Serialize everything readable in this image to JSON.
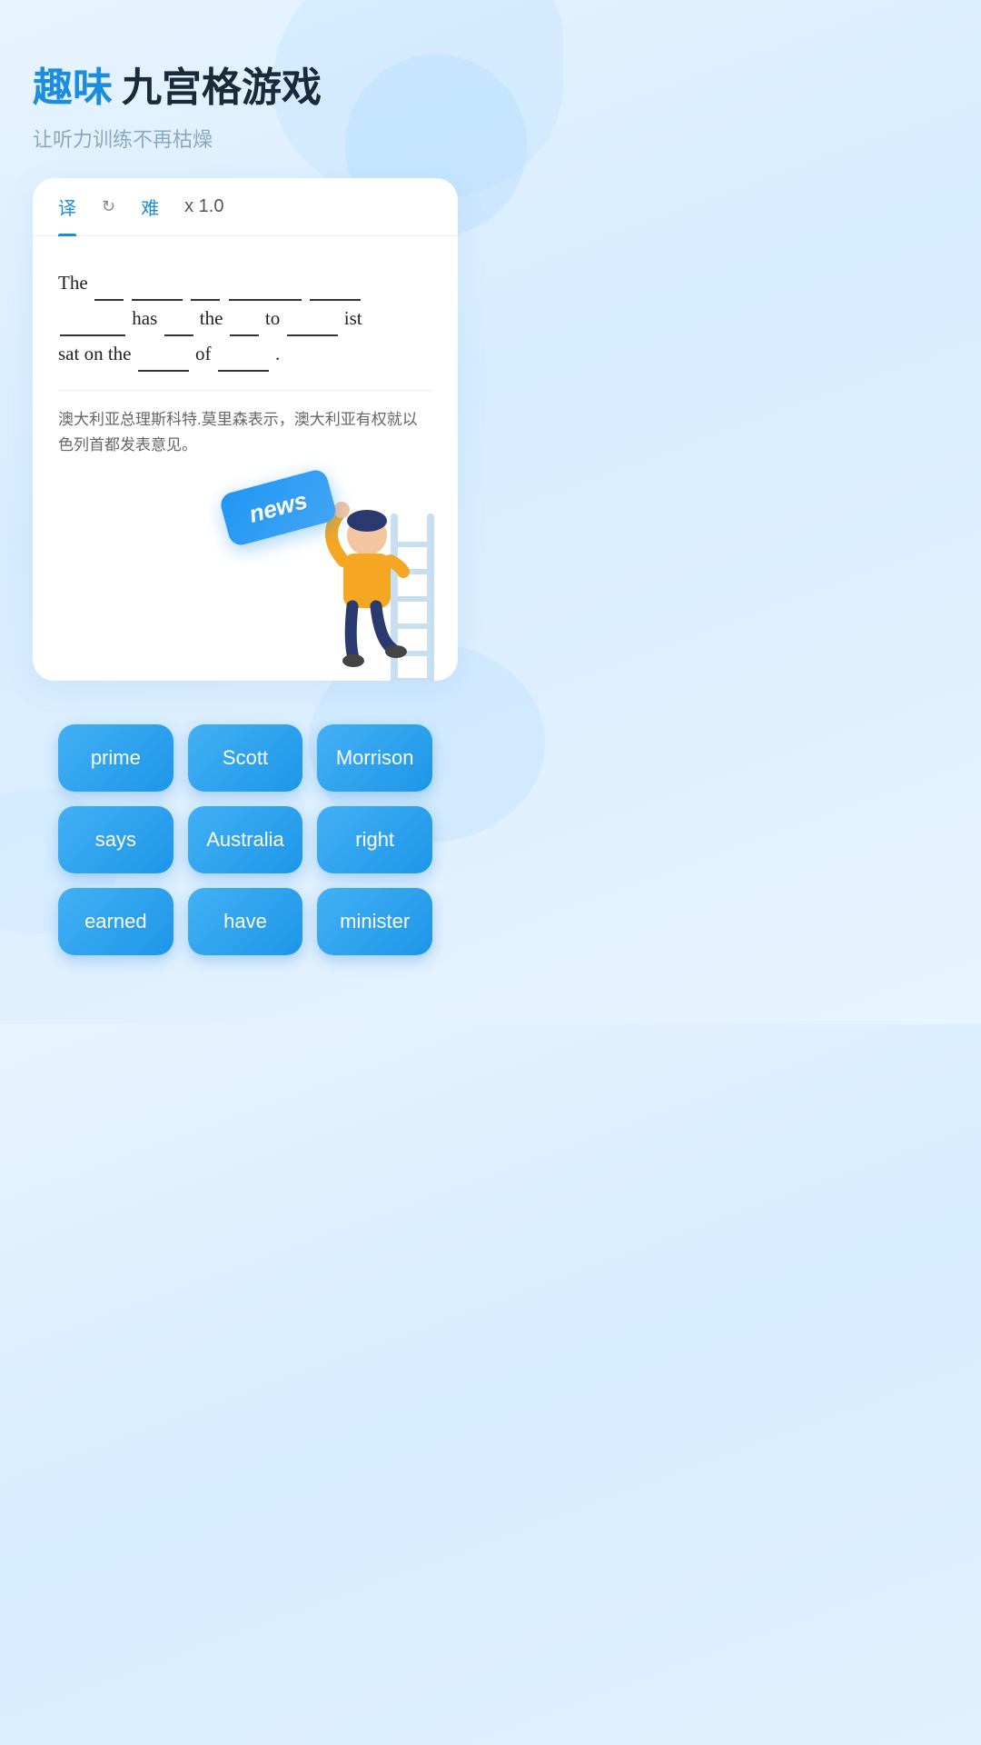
{
  "header": {
    "title_fun": "趣味",
    "title_main": "九宫格游戏",
    "subtitle": "让听力训练不再枯燥"
  },
  "tabs": [
    {
      "label": "译",
      "active": true
    },
    {
      "label": "↻",
      "icon": true
    },
    {
      "label": "难"
    },
    {
      "label": "x 1.0"
    }
  ],
  "sentence": {
    "line1_before": "The",
    "line2_mid": "has",
    "line2_to": "the",
    "line2_to2": "to",
    "line2_end": "ist",
    "line3_start": "sat on the",
    "line3_of": "of",
    "line3_end": "."
  },
  "translation": "澳大利亚总理斯科特.莫里森表示，澳大利亚有权就以色列首都发表意见。",
  "news_tile": "news",
  "words": [
    {
      "label": "prime"
    },
    {
      "label": "Scott"
    },
    {
      "label": "Morrison"
    },
    {
      "label": "says"
    },
    {
      "label": "Australia"
    },
    {
      "label": "right"
    },
    {
      "label": "earned"
    },
    {
      "label": "have"
    },
    {
      "label": "minister"
    }
  ]
}
